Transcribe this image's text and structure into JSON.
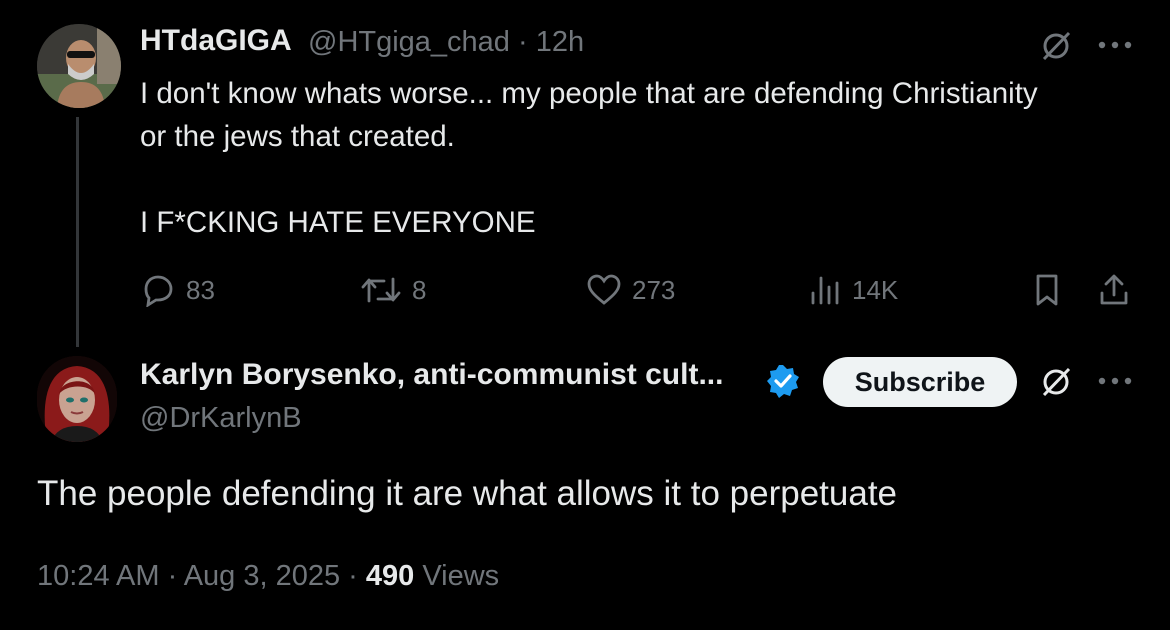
{
  "tweet": {
    "author_name": "HTdaGIGA",
    "author_handle": "@HTgiga_chad · 12h",
    "lines": [
      "I don't know whats worse... my people that are defending Christianity",
      "or the jews that created.",
      "",
      "I F*CKING HATE EVERYONE"
    ],
    "actions": {
      "replies": "83",
      "reposts": "8",
      "likes": "273",
      "views": "14K"
    }
  },
  "reply": {
    "author_name": "Karlyn Borysenko, anti-communist cult...",
    "author_handle": "@DrKarlynB",
    "verified": true,
    "subscribe_label": "Subscribe",
    "text": "The people defending it are what allows it to perpetuate",
    "timestamp": "10:24 AM · Aug 3, 2025 · ",
    "views_count": "490",
    "views_label": " Views"
  },
  "colors": {
    "background": "#000000",
    "primary_text": "#e7e9ea",
    "secondary_text": "#71767b",
    "verified_blue": "#1d9bf0",
    "subscribe_bg": "#eff3f4"
  },
  "icons": [
    "grok-icon",
    "more-icon",
    "reply-icon",
    "repost-icon",
    "like-icon",
    "views-icon",
    "bookmark-icon",
    "share-icon",
    "verified-badge-icon"
  ]
}
